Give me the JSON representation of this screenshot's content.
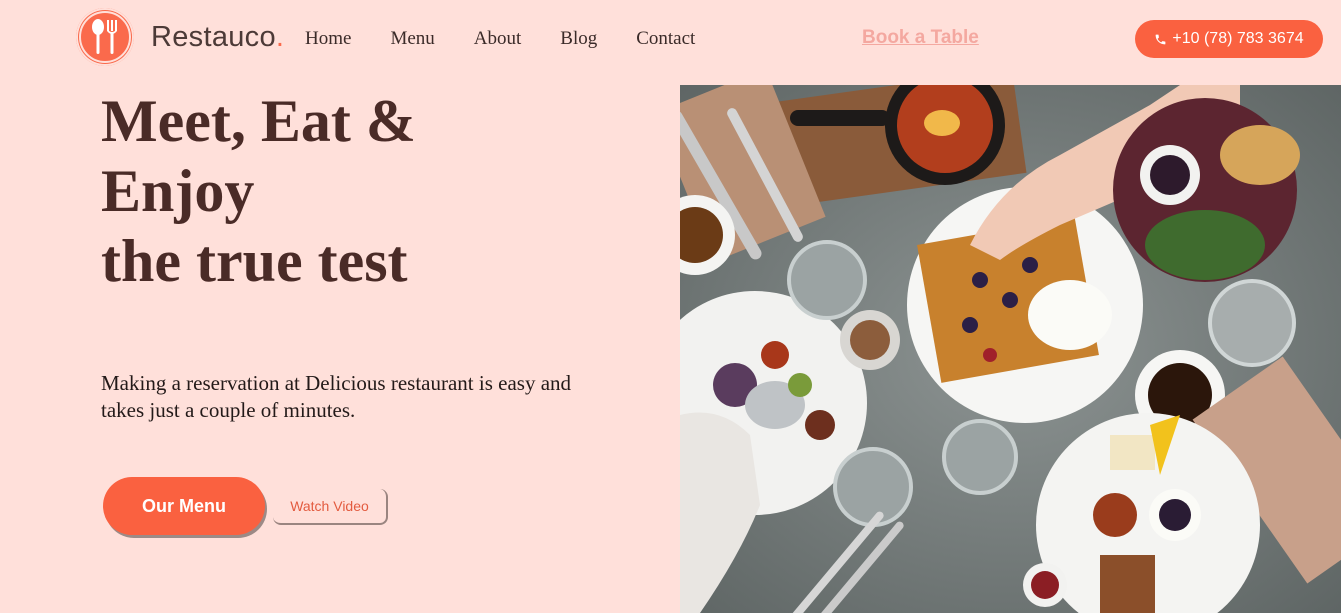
{
  "brand": {
    "name": "Restauco",
    "dot": ".",
    "accent_color": "#fa6140",
    "background_color": "#ffe0da",
    "logo_icon": "spoon-fork-icon"
  },
  "nav": {
    "items": [
      {
        "label": "Home"
      },
      {
        "label": "Menu"
      },
      {
        "label": "About"
      },
      {
        "label": "Blog"
      },
      {
        "label": "Contact"
      }
    ]
  },
  "header": {
    "book_label": "Book a Table",
    "phone_icon": "phone-icon",
    "phone_label": "+10 (78) 783 3674"
  },
  "hero": {
    "title_lines": [
      "Meet, Eat &",
      "Enjoy",
      "the true test"
    ],
    "text_lines": [
      "Making a reservation at Delicious restaurant is easy and",
      "takes just a couple of minutes."
    ],
    "primary_button": "Our Menu",
    "secondary_button": "Watch Video"
  },
  "image": {
    "subject": "food-table-photo"
  }
}
